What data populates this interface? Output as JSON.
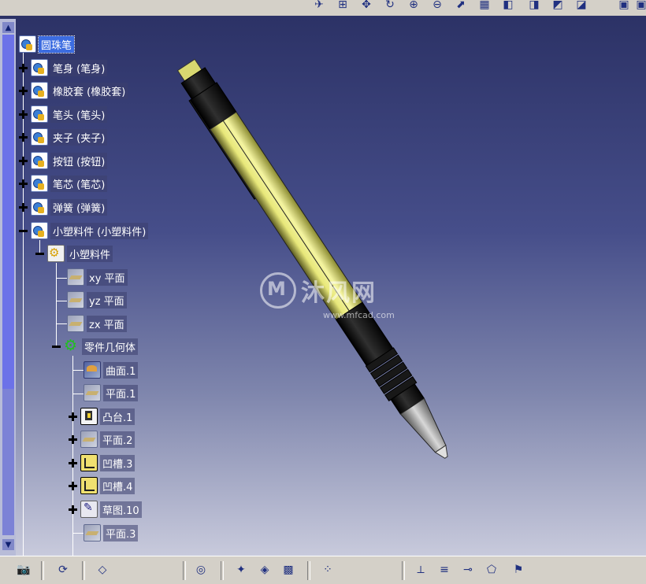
{
  "tree": {
    "root": {
      "label": "圆珠笔",
      "icon": "product-icon"
    },
    "components": [
      {
        "label": "笔身 (笔身)"
      },
      {
        "label": "橡胶套 (橡胶套)"
      },
      {
        "label": "笔头 (笔头)"
      },
      {
        "label": "夹子 (夹子)"
      },
      {
        "label": "按钮 (按钮)"
      },
      {
        "label": "笔芯 (笔芯)"
      },
      {
        "label": "弹簧 (弹簧)"
      },
      {
        "label": "小塑料件 (小塑料件)"
      }
    ],
    "part": {
      "label": "小塑料件"
    },
    "planes": [
      {
        "label": "xy 平面"
      },
      {
        "label": "yz 平面"
      },
      {
        "label": "zx 平面"
      }
    ],
    "body": {
      "label": "零件几何体"
    },
    "features": [
      {
        "label": "曲面.1",
        "icon": "surface-icon"
      },
      {
        "label": "平面.1",
        "icon": "plane-icon"
      },
      {
        "label": "凸台.1",
        "icon": "pad-icon"
      },
      {
        "label": "平面.2",
        "icon": "plane-icon"
      },
      {
        "label": "凹槽.3",
        "icon": "groove-icon"
      },
      {
        "label": "凹槽.4",
        "icon": "groove-icon"
      },
      {
        "label": "草图.10",
        "icon": "sketch-icon"
      },
      {
        "label": "平面.3",
        "icon": "plane-icon"
      }
    ]
  },
  "watermark": {
    "text": "沐风网",
    "url": "www.mfcad.com"
  },
  "colors": {
    "viewport_top": "#2c3266",
    "viewport_bottom": "#c8cadc",
    "pen_body": "#e8e87a",
    "pen_grip": "#101010",
    "selection": "#3c6ce0"
  }
}
